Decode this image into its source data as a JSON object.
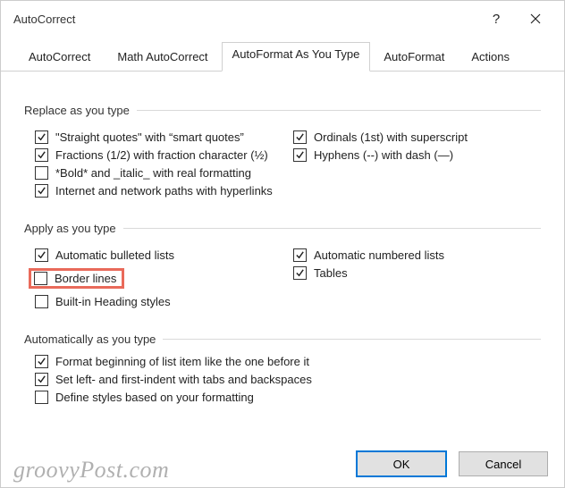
{
  "titlebar": {
    "title": "AutoCorrect",
    "help_symbol": "?"
  },
  "tabs": {
    "autocorrect": "AutoCorrect",
    "math": "Math AutoCorrect",
    "autoformat_type": "AutoFormat As You Type",
    "autoformat": "AutoFormat",
    "actions": "Actions"
  },
  "sections": {
    "replace": {
      "title": "Replace as you type",
      "items": {
        "quotes": {
          "label": "\"Straight quotes\" with “smart quotes”",
          "checked": true
        },
        "fractions": {
          "label": "Fractions (1/2) with fraction character (½)",
          "checked": true
        },
        "bold": {
          "label": "*Bold* and _italic_ with real formatting",
          "checked": false
        },
        "hyperlinks": {
          "label": "Internet and network paths with hyperlinks",
          "checked": true
        },
        "ordinals": {
          "label": "Ordinals (1st) with superscript",
          "checked": true
        },
        "hyphens": {
          "label": "Hyphens (--) with dash (—)",
          "checked": true
        }
      }
    },
    "apply": {
      "title": "Apply as you type",
      "items": {
        "bulleted": {
          "label": "Automatic bulleted lists",
          "checked": true
        },
        "border": {
          "label": "Border lines",
          "checked": false
        },
        "heading": {
          "label": "Built-in Heading styles",
          "checked": false
        },
        "numbered": {
          "label": "Automatic numbered lists",
          "checked": true
        },
        "tables": {
          "label": "Tables",
          "checked": true
        }
      }
    },
    "auto": {
      "title": "Automatically as you type",
      "items": {
        "format_beginning": {
          "label": "Format beginning of list item like the one before it",
          "checked": true
        },
        "indent": {
          "label": "Set left- and first-indent with tabs and backspaces",
          "checked": true
        },
        "define_styles": {
          "label": "Define styles based on your formatting",
          "checked": false
        }
      }
    }
  },
  "buttons": {
    "ok": "OK",
    "cancel": "Cancel"
  },
  "watermark": "groovyPost.com"
}
